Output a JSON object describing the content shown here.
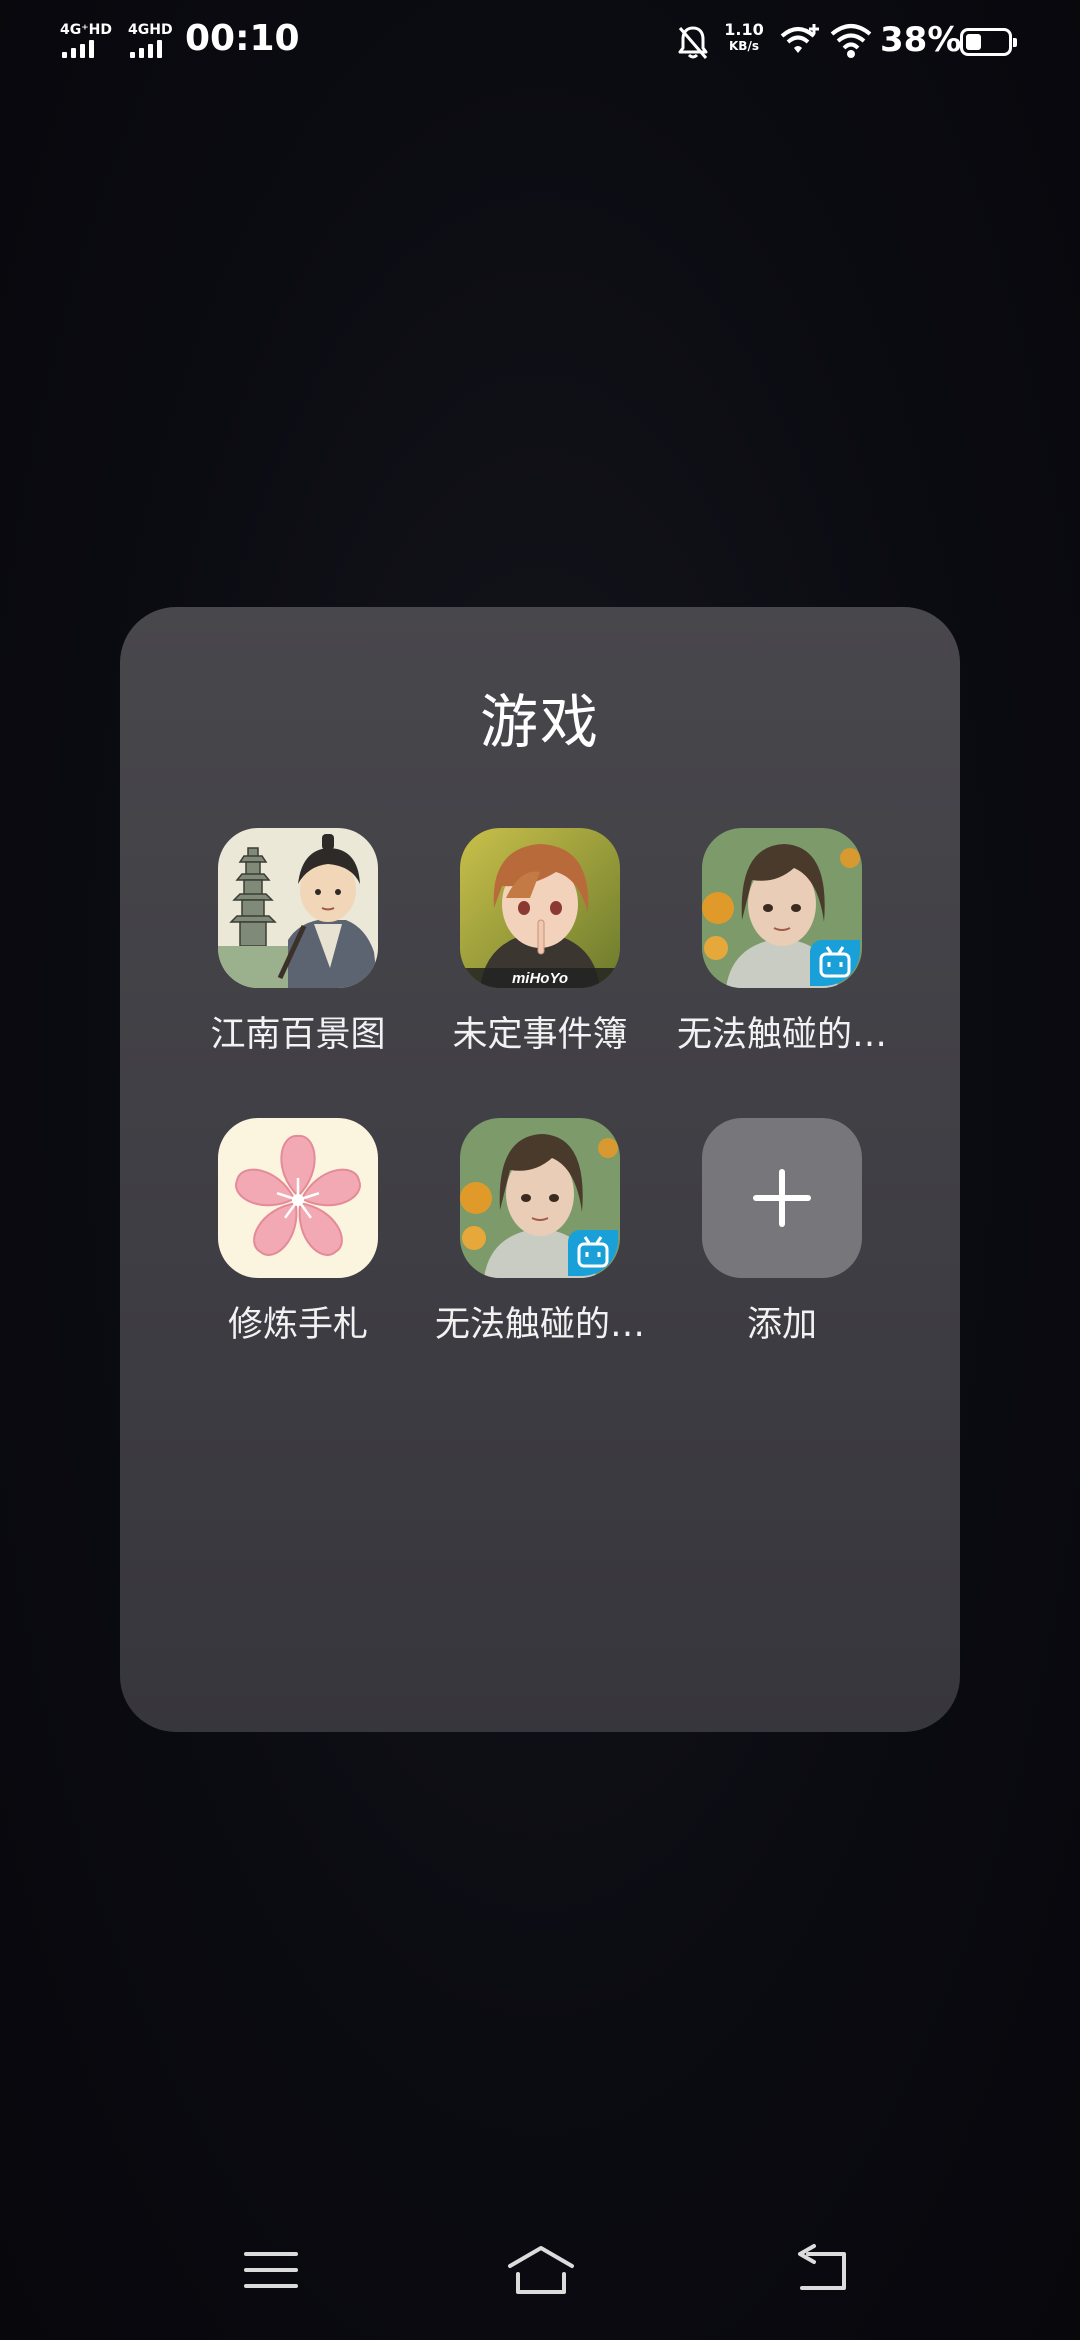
{
  "status_bar": {
    "sim1_network": "4G⁺HD",
    "sim2_network": "4GHD",
    "time": "00:10",
    "net_speed_value": "1.10",
    "net_speed_unit": "KB/s",
    "battery_percent": "38%",
    "battery_level": 0.38,
    "icons": [
      "signal-icon",
      "signal-icon",
      "bell-off-icon",
      "wifi-calling-icon",
      "wifi-icon",
      "battery-icon"
    ]
  },
  "folder": {
    "title": "游戏",
    "apps": [
      {
        "label": "江南百景图",
        "icon": "jiangnan-baijingtu-app-icon"
      },
      {
        "label": "未定事件簿",
        "icon": "weiding-shijianbu-app-icon"
      },
      {
        "label": "无法触碰的…",
        "icon": "wufa-chupeng-app-icon"
      },
      {
        "label": "修炼手札",
        "icon": "xiulian-shouzha-app-icon"
      },
      {
        "label": "无法触碰的…",
        "icon": "wufa-chupeng-app-icon"
      },
      {
        "label": "添加",
        "icon": "plus-icon"
      }
    ]
  },
  "icon_texts": {
    "mihoyo": "miHoYo"
  },
  "nav_bar": {
    "icons": [
      "menu-icon",
      "home-icon",
      "back-icon"
    ]
  }
}
